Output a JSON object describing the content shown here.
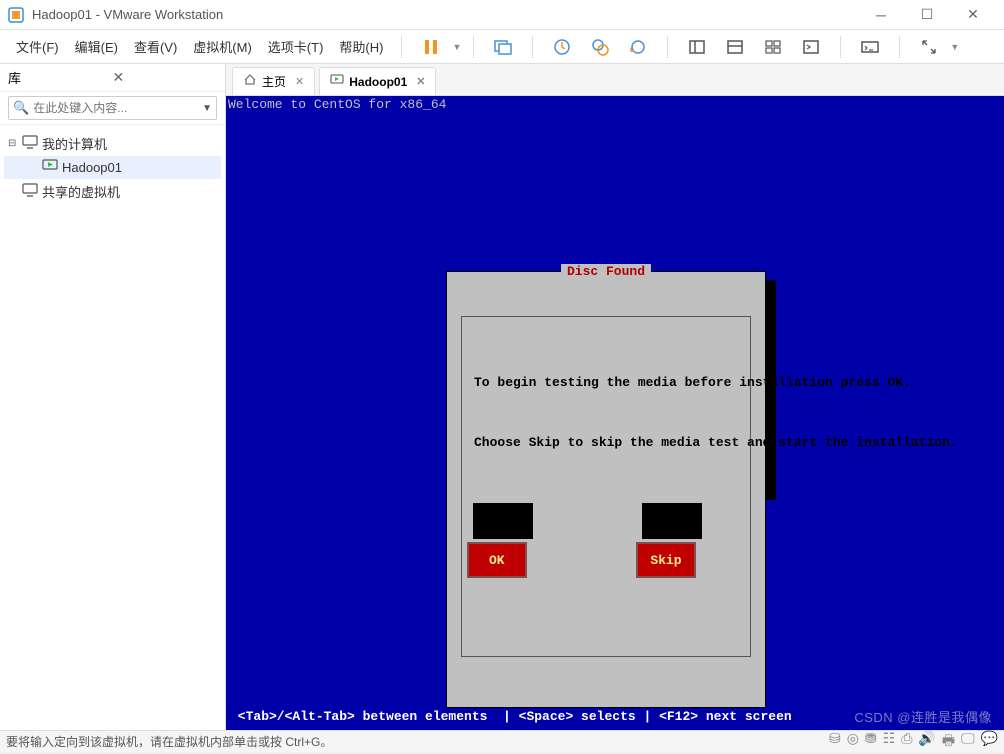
{
  "window": {
    "title": "Hadoop01 - VMware Workstation"
  },
  "menu": {
    "file": "文件(F)",
    "edit": "编辑(E)",
    "view": "查看(V)",
    "vm": "虚拟机(M)",
    "tabs": "选项卡(T)",
    "help": "帮助(H)"
  },
  "library": {
    "title": "库",
    "search_placeholder": "在此处键入内容...",
    "my_computer": "我的计算机",
    "vm1": "Hadoop01",
    "shared": "共享的虚拟机"
  },
  "tabs": {
    "home": "主页",
    "vm": "Hadoop01"
  },
  "console": {
    "welcome": "Welcome to CentOS for x86_64",
    "dialog_title": "Disc Found",
    "dialog_text1": "To begin testing the media before installation press OK.",
    "dialog_text2": "Choose Skip to skip the media test and start the installation.",
    "btn_ok": "OK",
    "btn_skip": "Skip",
    "footer": " <Tab>/<Alt-Tab> between elements  | <Space> selects | <F12> next screen"
  },
  "status": {
    "text": "要将输入定向到该虚拟机，请在虚拟机内部单击或按 Ctrl+G。"
  },
  "watermark": "CSDN @连胜是我偶像"
}
